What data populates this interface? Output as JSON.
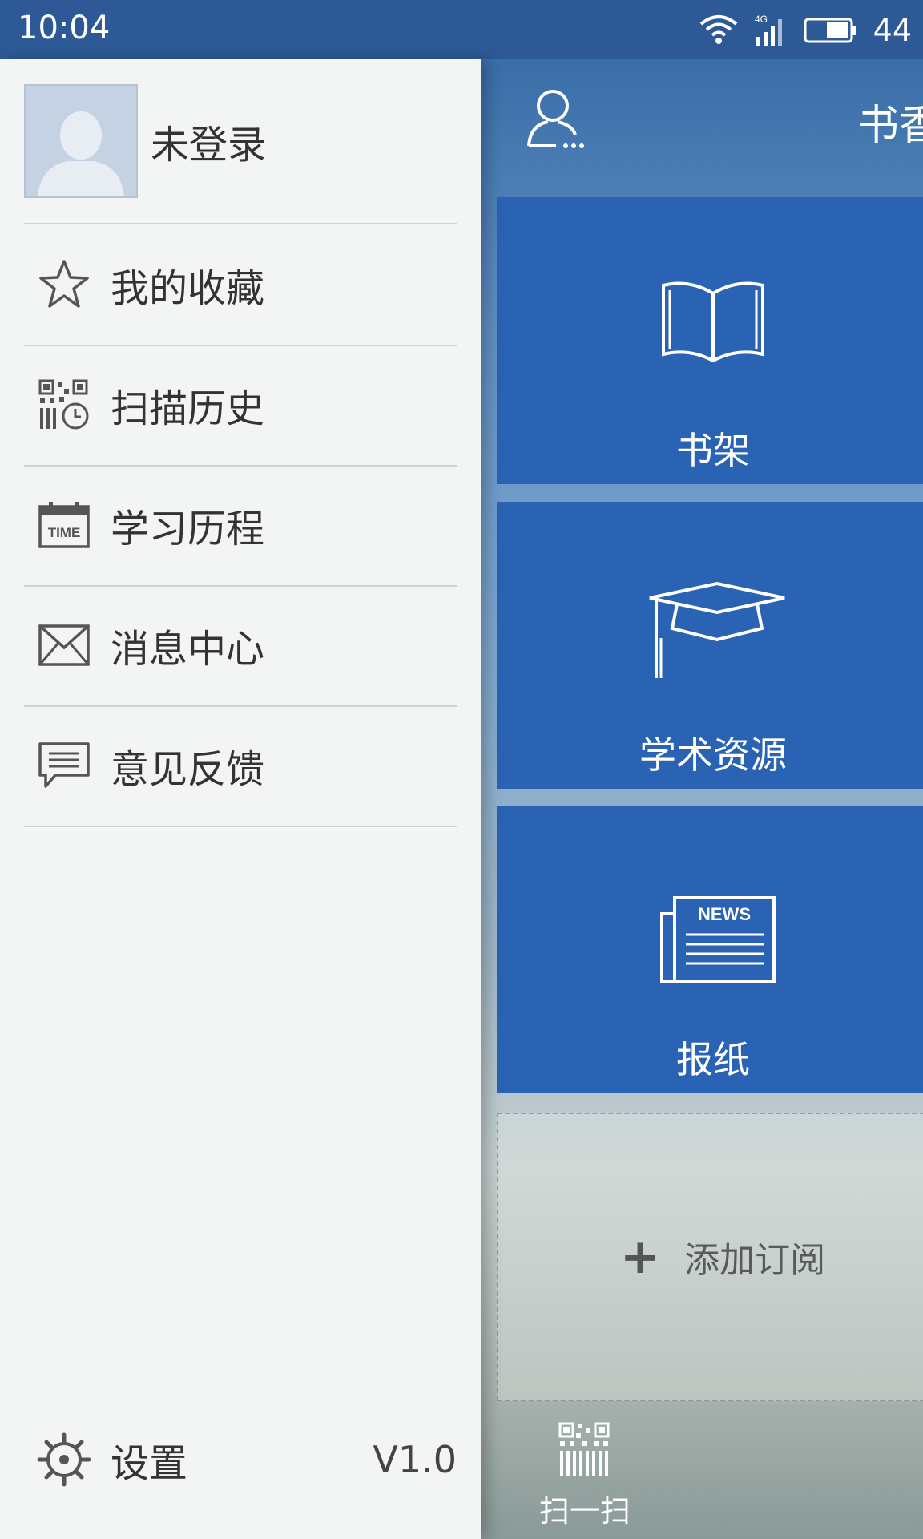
{
  "status_bar": {
    "time": "10:04",
    "network": "4G",
    "battery_level": "44"
  },
  "main": {
    "title": "书香",
    "tiles": [
      {
        "label": "书架",
        "icon": "book-icon"
      },
      {
        "label": "学术资源",
        "icon": "graduation-cap-icon"
      },
      {
        "label": "报纸",
        "icon": "newspaper-icon",
        "icon_text": "NEWS"
      }
    ],
    "add_subscription": "添加订阅",
    "scan_label": "扫一扫"
  },
  "drawer": {
    "profile_name": "未登录",
    "menu": [
      {
        "label": "我的收藏",
        "icon": "star-icon"
      },
      {
        "label": "扫描历史",
        "icon": "qr-history-icon"
      },
      {
        "label": "学习历程",
        "icon": "calendar-time-icon",
        "icon_text": "TIME"
      },
      {
        "label": "消息中心",
        "icon": "envelope-icon"
      },
      {
        "label": "意见反馈",
        "icon": "speech-bubble-icon"
      }
    ],
    "settings_label": "设置",
    "version": "V1.0"
  },
  "colors": {
    "status_bar": "#2d5a96",
    "tile_blue": "#2a63b3",
    "drawer_bg": "#f3f4f4"
  }
}
